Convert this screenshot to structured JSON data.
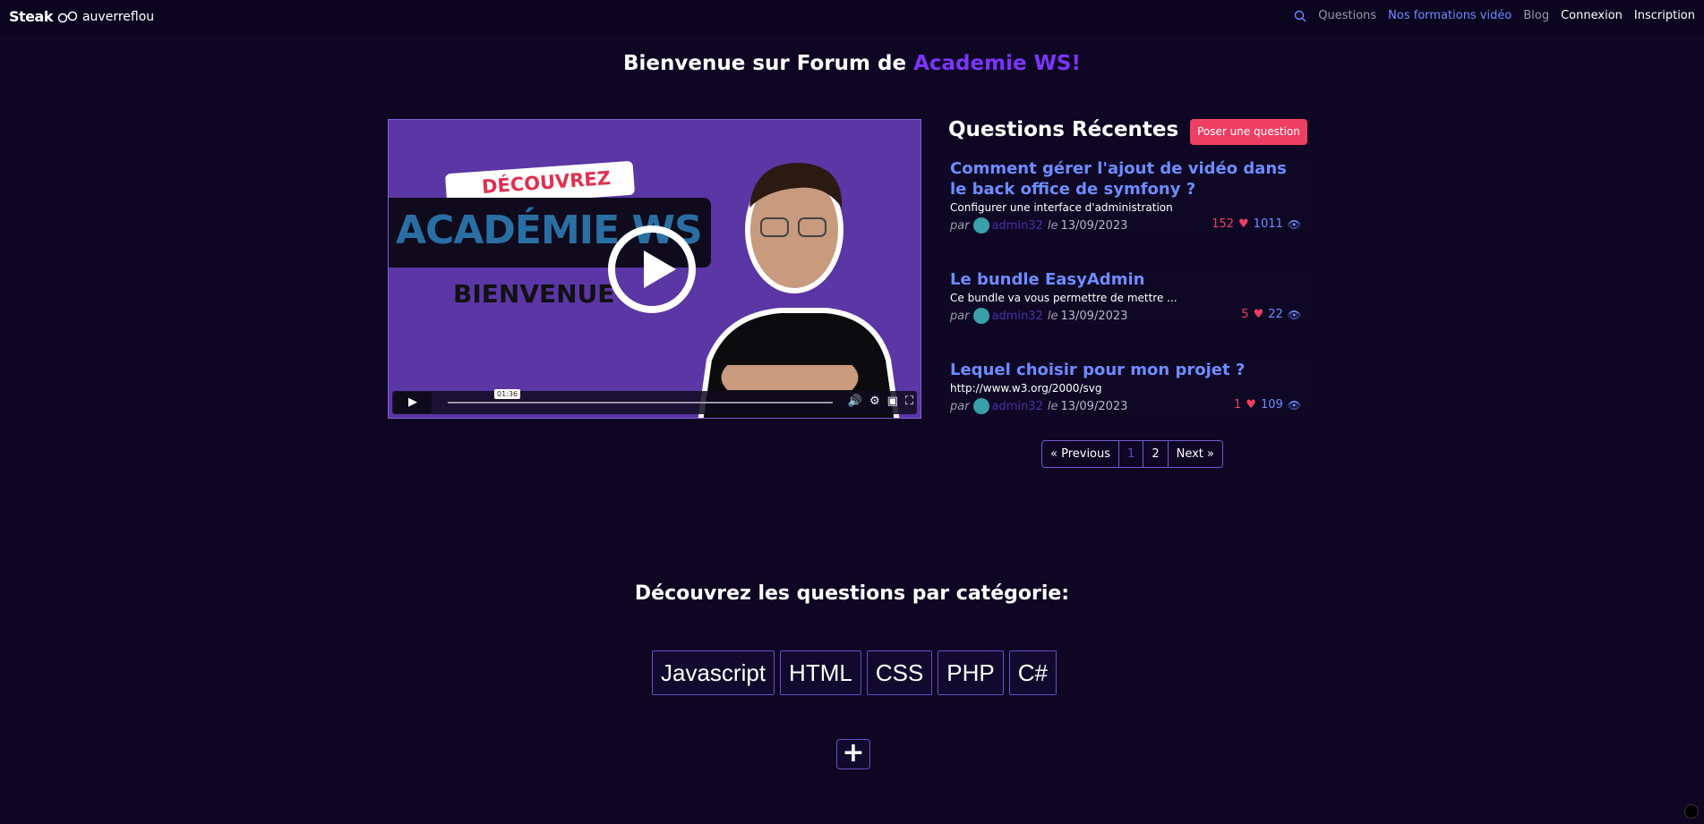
{
  "nav": {
    "logo_brand": "Steak",
    "logo_text": "auverreflou",
    "links": [
      {
        "label": "Questions",
        "style": "muted"
      },
      {
        "label": "Nos formations vidéo",
        "style": "active"
      },
      {
        "label": "Blog",
        "style": "muted"
      },
      {
        "label": "Connexion",
        "style": "white"
      },
      {
        "label": "Inscription",
        "style": "white"
      }
    ]
  },
  "welcome": {
    "prefix": "Bienvenue sur Forum de ",
    "accent": "Academie WS!"
  },
  "video": {
    "discover": "DÉCOUVREZ",
    "title": "ACADÉMIE WS",
    "subtitle": "BIENVENUE",
    "time": "01:36"
  },
  "questions": {
    "heading": "Questions Récentes",
    "ask_label": "Poser une question",
    "items": [
      {
        "title": "Comment gérer l'ajout de vidéo dans le back office de symfony ?",
        "summary": "Configurer une interface d'administration",
        "par": "par",
        "author": "admin32",
        "le": "le",
        "date": "13/09/2023",
        "likes": "152",
        "views": "1011"
      },
      {
        "title": "Le bundle EasyAdmin",
        "summary": "Ce bundle va vous permettre de mettre ...",
        "par": "par",
        "author": "admin32",
        "le": "le",
        "date": "13/09/2023",
        "likes": "5",
        "views": "22"
      },
      {
        "title": "Lequel choisir pour mon projet ?",
        "summary": "http://www.w3.org/2000/svg",
        "par": "par",
        "author": "admin32",
        "le": "le",
        "date": "13/09/2023",
        "likes": "1",
        "views": "109"
      }
    ]
  },
  "pagination": {
    "prev": "« Previous",
    "pages": [
      "1",
      "2"
    ],
    "current": "1",
    "next": "Next »"
  },
  "categories": {
    "heading": "Découvrez les questions par catégorie:",
    "items": [
      "Javascript",
      "HTML",
      "CSS",
      "PHP",
      "C#"
    ],
    "more_label": "+"
  },
  "colors": {
    "background": "#0e0623",
    "accent": "#7b35ff",
    "link": "#6e8cff",
    "danger": "#ee3f63"
  }
}
